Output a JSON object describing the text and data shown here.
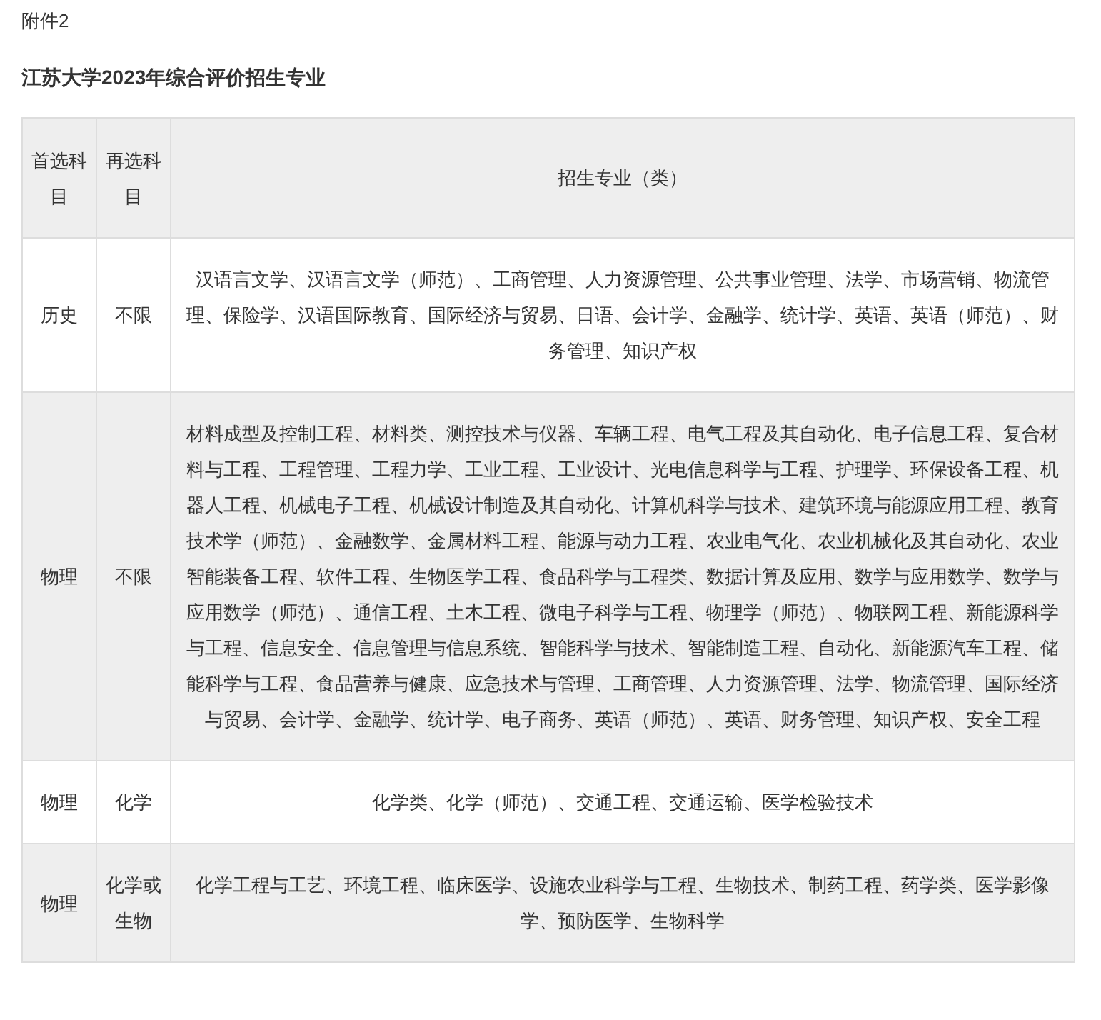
{
  "attachment_label": "附件2",
  "title": "江苏大学2023年综合评价招生专业",
  "table": {
    "columns": [
      "首选科目",
      "再选科目",
      "招生专业（类）"
    ],
    "rows": [
      {
        "first_subject": "历史",
        "second_subject": "不限",
        "majors": "汉语言文学、汉语言文学（师范）、工商管理、人力资源管理、公共事业管理、法学、市场营销、物流管理、保险学、汉语国际教育、国际经济与贸易、日语、会计学、金融学、统计学、英语、英语（师范）、财务管理、知识产权"
      },
      {
        "first_subject": "物理",
        "second_subject": "不限",
        "majors": "材料成型及控制工程、材料类、测控技术与仪器、车辆工程、电气工程及其自动化、电子信息工程、复合材料与工程、工程管理、工程力学、工业工程、工业设计、光电信息科学与工程、护理学、环保设备工程、机器人工程、机械电子工程、机械设计制造及其自动化、计算机科学与技术、建筑环境与能源应用工程、教育技术学（师范）、金融数学、金属材料工程、能源与动力工程、农业电气化、农业机械化及其自动化、农业智能装备工程、软件工程、生物医学工程、食品科学与工程类、数据计算及应用、数学与应用数学、数学与应用数学（师范）、通信工程、土木工程、微电子科学与工程、物理学（师范）、物联网工程、新能源科学与工程、信息安全、信息管理与信息系统、智能科学与技术、智能制造工程、自动化、新能源汽车工程、储能科学与工程、食品营养与健康、应急技术与管理、工商管理、人力资源管理、法学、物流管理、国际经济与贸易、会计学、金融学、统计学、电子商务、英语（师范）、英语、财务管理、知识产权、安全工程"
      },
      {
        "first_subject": "物理",
        "second_subject": "化学",
        "majors": "化学类、化学（师范）、交通工程、交通运输、医学检验技术"
      },
      {
        "first_subject": "物理",
        "second_subject": "化学或生物",
        "majors": "化学工程与工艺、环境工程、临床医学、设施农业科学与工程、生物技术、制药工程、药学类、医学影像学、预防医学、生物科学"
      }
    ]
  }
}
